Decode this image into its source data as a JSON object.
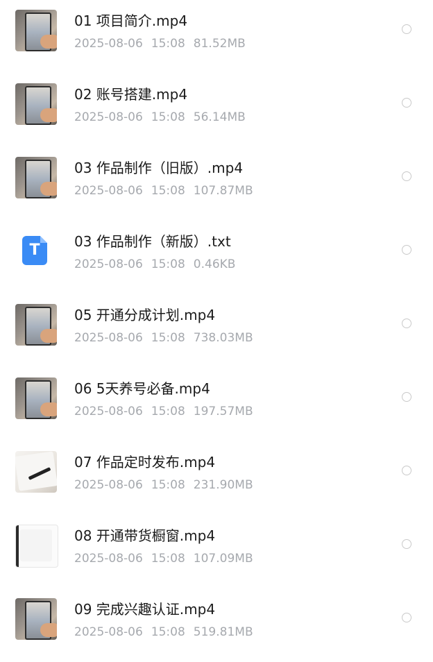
{
  "files": [
    {
      "name": "01 项目简介.mp4",
      "date": "2025-08-06",
      "time": "15:08",
      "size": "81.52MB",
      "kind": "video",
      "thumb_icon": "video-thumbnail-icon",
      "selected": false
    },
    {
      "name": "02 账号搭建.mp4",
      "date": "2025-08-06",
      "time": "15:08",
      "size": "56.14MB",
      "kind": "video",
      "thumb_icon": "video-thumbnail-icon",
      "selected": false
    },
    {
      "name": "03 作品制作（旧版）.mp4",
      "date": "2025-08-06",
      "time": "15:08",
      "size": "107.87MB",
      "kind": "video",
      "thumb_icon": "video-thumbnail-icon",
      "selected": false
    },
    {
      "name": "03 作品制作（新版）.txt",
      "date": "2025-08-06",
      "time": "15:08",
      "size": "0.46KB",
      "kind": "text",
      "thumb_icon": "text-file-icon",
      "selected": false
    },
    {
      "name": "05 开通分成计划.mp4",
      "date": "2025-08-06",
      "time": "15:08",
      "size": "738.03MB",
      "kind": "video",
      "thumb_icon": "video-thumbnail-icon",
      "selected": false
    },
    {
      "name": "06 5天养号必备.mp4",
      "date": "2025-08-06",
      "time": "15:08",
      "size": "197.57MB",
      "kind": "video",
      "thumb_icon": "video-thumbnail-icon",
      "selected": false
    },
    {
      "name": "07 作品定时发布.mp4",
      "date": "2025-08-06",
      "time": "15:08",
      "size": "231.90MB",
      "kind": "video",
      "thumb_icon": "video-thumbnail-icon",
      "selected": false
    },
    {
      "name": "08 开通带货橱窗.mp4",
      "date": "2025-08-06",
      "time": "15:08",
      "size": "107.09MB",
      "kind": "video",
      "thumb_icon": "video-thumbnail-icon",
      "selected": false
    },
    {
      "name": "09 完成兴趣认证.mp4",
      "date": "2025-08-06",
      "time": "15:08",
      "size": "519.81MB",
      "kind": "video",
      "thumb_icon": "video-thumbnail-icon",
      "selected": false
    }
  ],
  "doc_icon_glyph": "T",
  "colors": {
    "name_text": "#1a1a1a",
    "meta_text": "#a6a9ae",
    "doc_icon": "#3a8bf5",
    "radio_border": "#c9c9c9"
  }
}
